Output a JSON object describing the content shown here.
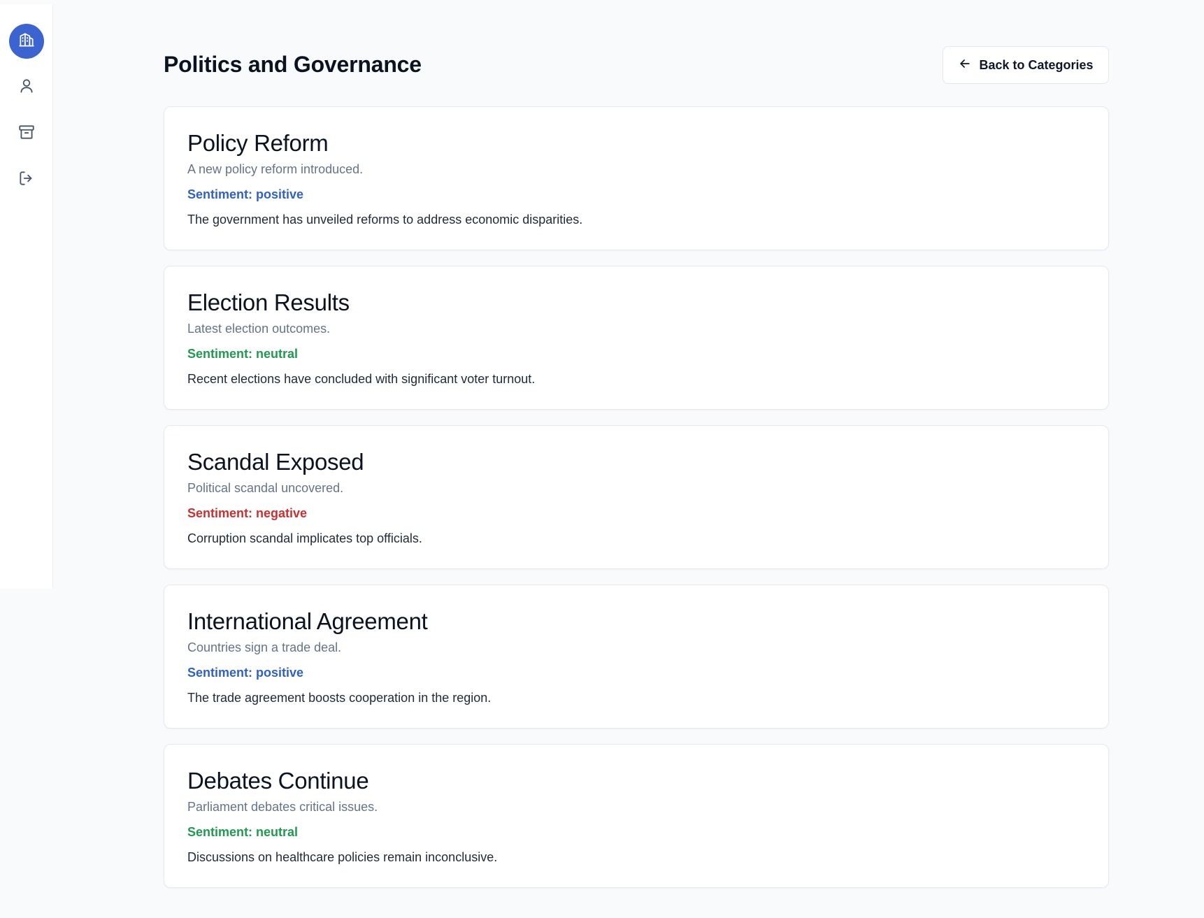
{
  "sidebar": {
    "items": [
      {
        "icon": "building-icon",
        "label": ""
      },
      {
        "icon": "user-icon",
        "label": ""
      },
      {
        "icon": "archive-icon",
        "label": ""
      },
      {
        "icon": "logout-icon",
        "label": ""
      }
    ]
  },
  "header": {
    "title": "Politics and Governance",
    "back_label": "Back to Categories"
  },
  "articles": [
    {
      "title": "Policy Reform",
      "subtitle": "A new policy reform introduced.",
      "sentiment_label": "Sentiment: positive",
      "sentiment": "positive",
      "body": "The government has unveiled reforms to address economic disparities."
    },
    {
      "title": "Election Results",
      "subtitle": "Latest election outcomes.",
      "sentiment_label": "Sentiment: neutral",
      "sentiment": "neutral",
      "body": "Recent elections have concluded with significant voter turnout."
    },
    {
      "title": "Scandal Exposed",
      "subtitle": "Political scandal uncovered.",
      "sentiment_label": "Sentiment: negative",
      "sentiment": "negative",
      "body": "Corruption scandal implicates top officials."
    },
    {
      "title": "International Agreement",
      "subtitle": "Countries sign a trade deal.",
      "sentiment_label": "Sentiment: positive",
      "sentiment": "positive",
      "body": "The trade agreement boosts cooperation in the region."
    },
    {
      "title": "Debates Continue",
      "subtitle": "Parliament debates critical issues.",
      "sentiment_label": "Sentiment: neutral",
      "sentiment": "neutral",
      "body": "Discussions on healthcare policies remain inconclusive."
    }
  ],
  "colors": {
    "positive": "#2f62c4",
    "neutral": "#1f9a4f",
    "negative": "#cc2f2f",
    "accent": "#3b64d1"
  }
}
